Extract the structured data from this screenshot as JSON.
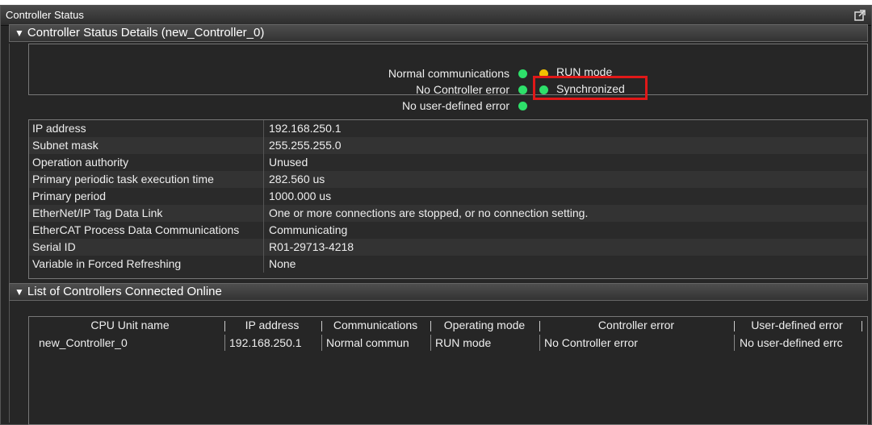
{
  "window": {
    "title": "Controller Status",
    "popout_icon": "popout-icon"
  },
  "status_section": {
    "header": "Controller Status Details (new_Controller_0)",
    "lamps": [
      {
        "label": "Normal communications",
        "color": "#2ee06a"
      },
      {
        "label": "No Controller error",
        "color": "#2ee06a"
      },
      {
        "label": "No user-defined error",
        "color": "#2ee06a"
      }
    ],
    "mode_lamps": [
      {
        "label": "RUN mode",
        "color": "#f2c200"
      },
      {
        "label": "Synchronized",
        "color": "#2ee06a"
      }
    ],
    "highlight_color": "#e01818"
  },
  "properties": [
    {
      "key": "IP address",
      "value": "192.168.250.1"
    },
    {
      "key": "Subnet mask",
      "value": "255.255.255.0"
    },
    {
      "key": "Operation authority",
      "value": "Unused"
    },
    {
      "key": "Primary periodic task execution time",
      "value": "282.560 us"
    },
    {
      "key": "Primary period",
      "value": "1000.000 us"
    },
    {
      "key": "EtherNet/IP Tag Data Link",
      "value": "One or more connections are stopped, or no connection setting."
    },
    {
      "key": "EtherCAT Process Data Communications",
      "value": "Communicating"
    },
    {
      "key": "Serial ID",
      "value": "R01-29713-4218"
    },
    {
      "key": "Variable in Forced Refreshing",
      "value": "None"
    }
  ],
  "online_section": {
    "header": "List of Controllers Connected Online",
    "columns": [
      "CPU Unit name",
      "IP address",
      "Communications",
      "Operating mode",
      "Controller error",
      "User-defined error"
    ],
    "rows": [
      [
        "new_Controller_0",
        "192.168.250.1",
        "Normal commun",
        "RUN mode",
        "No Controller error",
        "No user-defined errc"
      ]
    ]
  }
}
